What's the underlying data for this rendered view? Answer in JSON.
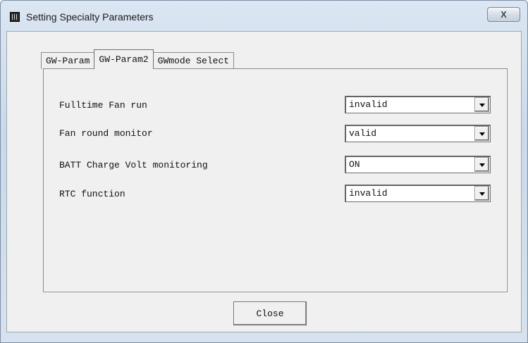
{
  "window": {
    "title": "Setting Specialty Parameters"
  },
  "titlebar": {
    "close_glyph": "X"
  },
  "tabs": [
    {
      "label": "GW-Param",
      "active": false
    },
    {
      "label": "GW-Param2",
      "active": true
    },
    {
      "label": "GWmode Select",
      "active": false
    }
  ],
  "settings": [
    {
      "label": "Fulltime Fan run",
      "value": "invalid"
    },
    {
      "label": "Fan round monitor",
      "value": "valid"
    },
    {
      "label": "BATT Charge Volt monitoring",
      "value": "ON"
    },
    {
      "label": "RTC function",
      "value": "invalid"
    }
  ],
  "footer": {
    "close_label": "Close"
  }
}
